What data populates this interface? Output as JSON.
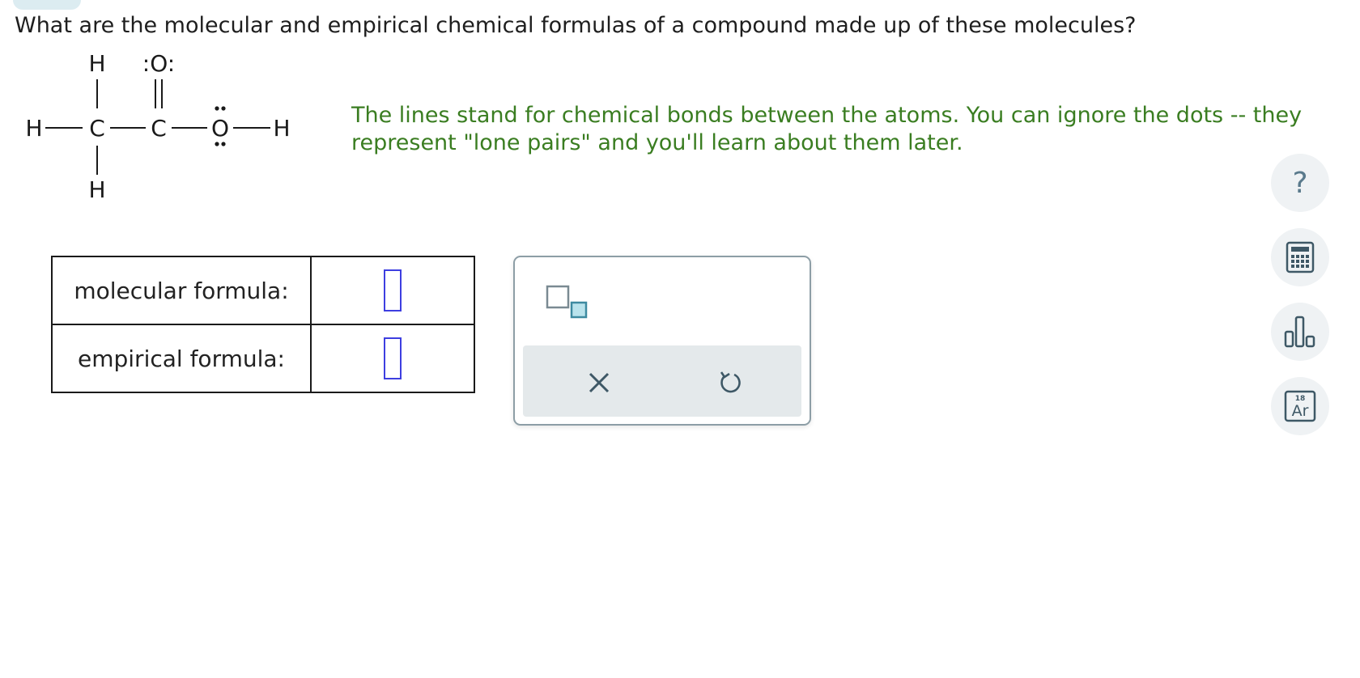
{
  "question": {
    "text": "What are the molecular and empirical chemical formulas of a compound made up of these molecules?"
  },
  "molecule": {
    "atoms": {
      "h_top": "H",
      "o_double": ":O:",
      "h_left": "H",
      "c_left": "C",
      "c_right": "C",
      "o_single": "O",
      "h_right": "H",
      "h_bottom": "H"
    }
  },
  "hint": {
    "text": "The lines stand for chemical bonds between the atoms. You can ignore the dots -- they represent \"lone pairs\" and you'll learn about them later."
  },
  "answers": {
    "rows": [
      {
        "label": "molecular formula:",
        "value": ""
      },
      {
        "label": "empirical formula:",
        "value": ""
      }
    ]
  },
  "palette": {
    "subscript_icon": "subscript-template-icon",
    "clear_icon": "x-icon",
    "undo_icon": "undo-icon"
  },
  "sidebar": {
    "help_glyph": "?",
    "calculator_icon": "calculator-icon",
    "chart_icon": "bar-chart-icon",
    "periodic": {
      "number": "18",
      "symbol": "Ar"
    }
  },
  "colors": {
    "hint": "#3a7d21",
    "answer_box": "#3d3ee0",
    "icon": "#5a7a8c",
    "action_bar": "#e4e9eb"
  }
}
